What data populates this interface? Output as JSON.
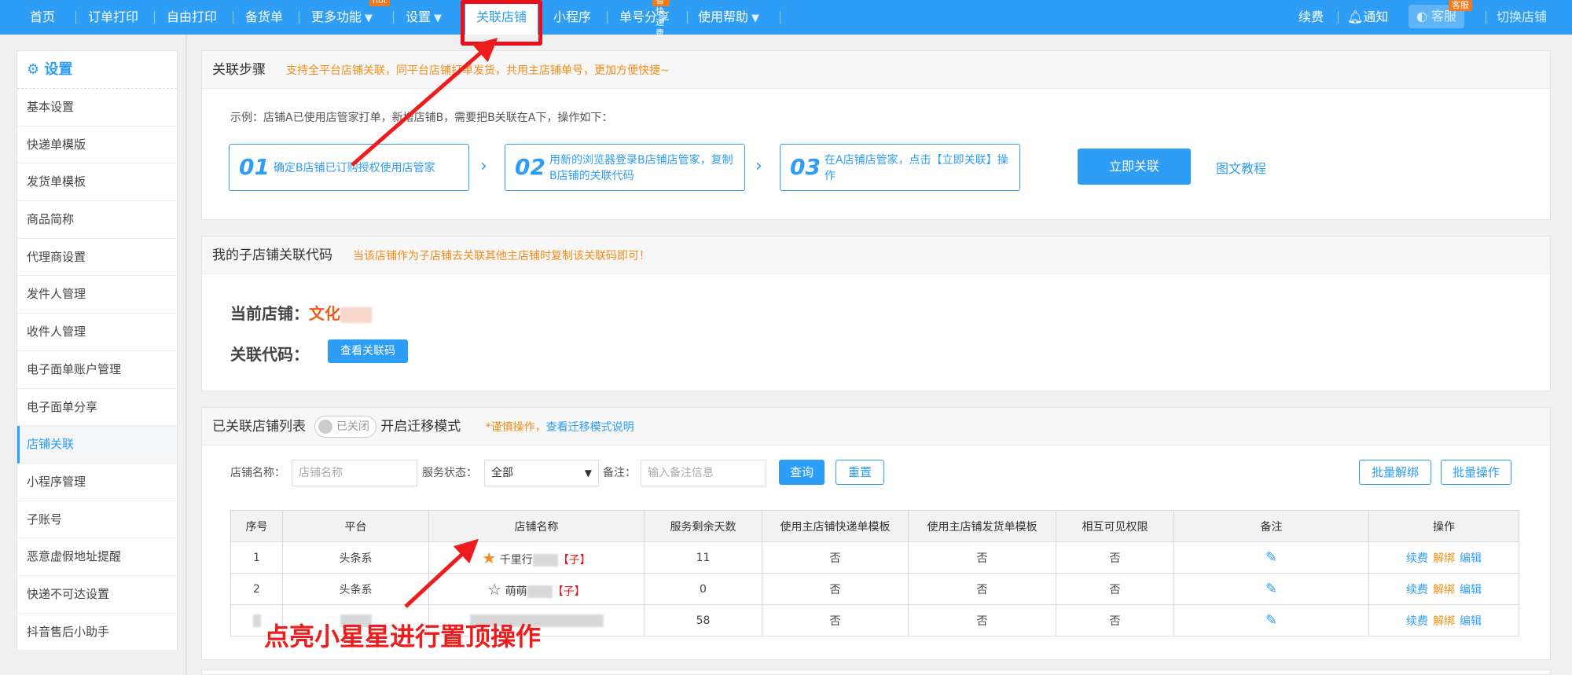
{
  "nav": {
    "items": [
      "首页",
      "订单打印",
      "自由打印",
      "备货单",
      "更多功能",
      "设置",
      "关联店铺",
      "小程序",
      "单号分享",
      "使用帮助"
    ],
    "badge_hot": "hot",
    "badge_express": "省快递费",
    "right": {
      "renew": "续费",
      "notify": "通知",
      "service": "客服",
      "service_badge": "客服",
      "switch_shop": "切换店铺"
    }
  },
  "sidebar": {
    "title": "设置",
    "items": [
      "基本设置",
      "快递单模版",
      "发货单模板",
      "商品简称",
      "代理商设置",
      "发件人管理",
      "收件人管理",
      "电子面单账户管理",
      "电子面单分享",
      "店铺关联",
      "小程序管理",
      "子账号",
      "恶意虚假地址提醒",
      "快递不可达设置",
      "抖音售后小助手"
    ],
    "active_index": 9
  },
  "steps_panel": {
    "title": "关联步骤",
    "tip": "支持全平台店铺关联，同平台店铺打单发货，共用主店铺单号，更加方便快捷~",
    "example": "示例：店铺A已使用店管家打单，新增店铺B，需要把B关联在A下，操作如下：",
    "steps": [
      {
        "num": "01",
        "text": "确定B店铺已订购授权使用店管家"
      },
      {
        "num": "02",
        "text": "用新的浏览器登录B店铺店管家，复制B店铺的关联代码"
      },
      {
        "num": "03",
        "text": "在A店铺店管家，点击【立即关联】操作"
      }
    ],
    "link_now": "立即关联",
    "tutorial": "图文教程"
  },
  "code_panel": {
    "title": "我的子店铺关联代码",
    "tip": "当该店铺作为子店铺去关联其他主店铺时复制该关联码即可！",
    "current_shop_label": "当前店铺：",
    "current_shop_value": "文化",
    "code_label": "关联代码：",
    "view_code": "查看关联码"
  },
  "list_panel": {
    "title": "已关联店铺列表",
    "toggle": "已关闭",
    "toggle_label": "开启迁移模式",
    "warn": "*谨慎操作，",
    "warn_link": "查看迁移模式说明",
    "filters": {
      "shop_name_label": "店铺名称：",
      "shop_name_placeholder": "店铺名称",
      "status_label": "服务状态：",
      "status_value": "全部",
      "remark_label": "备注：",
      "remark_placeholder": "输入备注信息",
      "query": "查询",
      "reset": "重置",
      "batch_unbind": "批量解绑",
      "batch_op": "批量操作"
    },
    "columns": [
      "序号",
      "平台",
      "店铺名称",
      "服务剩余天数",
      "使用主店铺快递单模板",
      "使用主店铺发货单模板",
      "相互可见权限",
      "备注",
      "操作"
    ],
    "rows": [
      {
        "no": "1",
        "platform": "头条系",
        "name": "千里行",
        "tag": "【子】",
        "starred": true,
        "days": "11",
        "express": "否",
        "ship": "否",
        "visible": "否"
      },
      {
        "no": "2",
        "platform": "头条系",
        "name": "萌萌",
        "tag": "【子】",
        "starred": false,
        "days": "0",
        "express": "否",
        "ship": "否",
        "visible": "否"
      },
      {
        "no": "",
        "platform": "",
        "name": "",
        "tag": "",
        "starred": false,
        "days": "58",
        "express": "否",
        "ship": "否",
        "visible": "否"
      }
    ],
    "ops": {
      "renew": "续费",
      "unbind": "解绑",
      "edit": "编辑"
    }
  },
  "annotation": "点亮小星星进行置顶操作"
}
